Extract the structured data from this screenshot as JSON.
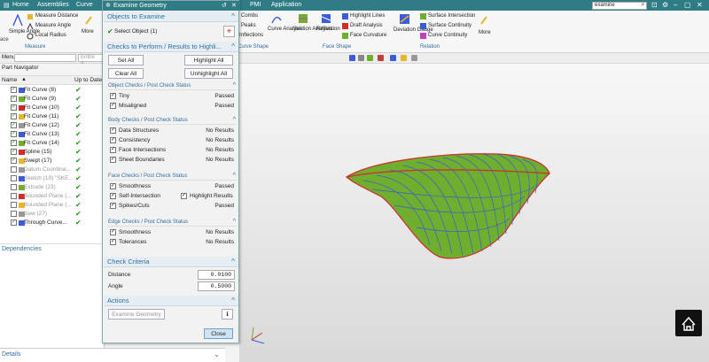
{
  "menubar": {
    "items": [
      "Home",
      "Assemblies",
      "Curve"
    ],
    "right_items": [
      "PMI",
      "Application"
    ],
    "search_value": "examine"
  },
  "ribbon": {
    "left_buttons": [
      "Simple\nAngle",
      "Measure Distance",
      "Measure Angle",
      "Local Radius",
      "More"
    ],
    "left_section": "Measure",
    "curve_buttons": [
      "Combs",
      "Peaks",
      "Inflections",
      "Curve\nAnalysis"
    ],
    "curve_section": "Curve Shape",
    "face_buttons": [
      "Section\nAnalysis",
      "Reflection",
      "Highlight Lines",
      "Draft Analysis",
      "Face Curvature"
    ],
    "face_section": "Face Shape",
    "relation_buttons": [
      "Deviation\nGauge",
      "Surface Intersection",
      "Surface Continuity",
      "Curve Continuity",
      "More"
    ],
    "relation_section": "Relation"
  },
  "toolbar": {
    "menu_label": "Menu",
    "filter_placeholder": "Entire A..."
  },
  "navigator": {
    "title": "Part Navigator",
    "col_name": "Name",
    "col_status": "Up to Date",
    "rows": [
      {
        "label": "Fit Curve (8)",
        "status": "✔",
        "active": true
      },
      {
        "label": "Fit Curve (9)",
        "status": "✔",
        "active": true
      },
      {
        "label": "Fit Curve (10)",
        "status": "✔",
        "active": true
      },
      {
        "label": "Fit Curve (11)",
        "status": "✔",
        "active": true
      },
      {
        "label": "Fit Curve (12)",
        "status": "✔",
        "active": true
      },
      {
        "label": "Fit Curve (13)",
        "status": "✔",
        "active": true
      },
      {
        "label": "Fit Curve (14)",
        "status": "✔",
        "active": true
      },
      {
        "label": "Spline (15)",
        "status": "✔",
        "active": true
      },
      {
        "label": "Swept (17)",
        "status": "✔",
        "active": true
      },
      {
        "label": "Datum Coordina...",
        "status": "✔",
        "active": false
      },
      {
        "label": "Sketch (19) \"SKE...",
        "status": "✔",
        "active": false
      },
      {
        "label": "Extrude (23)",
        "status": "✔",
        "active": false
      },
      {
        "label": "Bounded Plane (...",
        "status": "✔",
        "active": false
      },
      {
        "label": "Bounded Plane (...",
        "status": "✔",
        "active": false
      },
      {
        "label": "Sew (27)",
        "status": "✔",
        "active": false
      },
      {
        "label": "Through Curve...",
        "status": "✔",
        "active": true
      }
    ],
    "dependencies_label": "Dependencies",
    "details_label": "Details"
  },
  "dialog": {
    "title": "Examine Geometry",
    "objects_section": "Objects to Examine",
    "select_object": "Select Object (1)",
    "checks_section": "Checks to Perform / Results to Highli...",
    "btn_set_all": "Set All",
    "btn_clear_all": "Clear All",
    "btn_highlight_all": "Highlight All",
    "btn_unhighlight_all": "Unhighlight All",
    "object_checks": {
      "header": "Object Checks / Post Check Status",
      "items": [
        {
          "label": "Tiny",
          "value": "Passed"
        },
        {
          "label": "Misaligned",
          "value": "Passed"
        }
      ]
    },
    "body_checks": {
      "header": "Body Checks / Post Check Status",
      "items": [
        {
          "label": "Data Structures",
          "value": "No Results"
        },
        {
          "label": "Consistency",
          "value": "No Results"
        },
        {
          "label": "Face Intersections",
          "value": "No Results"
        },
        {
          "label": "Sheet Boundaries",
          "value": "No Results"
        }
      ]
    },
    "face_checks": {
      "header": "Face Checks / Post Check Status",
      "items": [
        {
          "label": "Smoothness",
          "value": "Passed"
        },
        {
          "label": "Self-Intersection",
          "value": "Highlight Results"
        },
        {
          "label": "Spikes/Cuts",
          "value": "Passed"
        }
      ]
    },
    "edge_checks": {
      "header": "Edge Checks / Post Check Status",
      "items": [
        {
          "label": "Smoothness",
          "value": "No Results"
        },
        {
          "label": "Tolerances",
          "value": "No Results"
        }
      ]
    },
    "criteria_section": "Check Criteria",
    "distance_label": "Distance",
    "distance_value": "0.0100",
    "angle_label": "Angle",
    "angle_value": "0.5000",
    "actions_section": "Actions",
    "btn_examine": "Examine Geometry",
    "btn_close": "Close"
  },
  "colors": {
    "titlebar": "#2f7c86",
    "accent": "#2f6fa0",
    "surface": "#6fae2e",
    "edge_curve": "#d12b2b",
    "iso_curve": "#3c5bd6"
  }
}
